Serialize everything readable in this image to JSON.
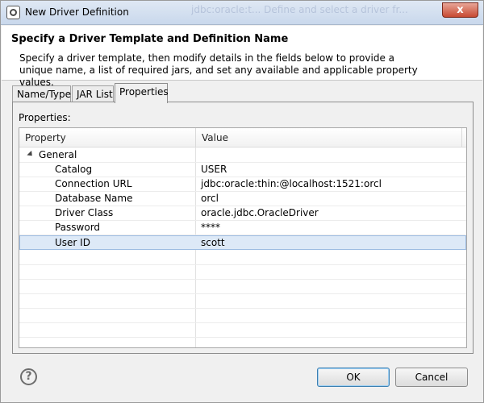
{
  "window": {
    "title": "New Driver Definition",
    "ghost_text": "jdbc:oracle:t...   Define and select a driver fr...",
    "close_label": "x"
  },
  "banner": {
    "title": "Specify a Driver Template and Definition Name",
    "description": "Specify a driver template, then modify details in the fields below to provide a unique name, a list of required jars, and set any available and applicable property values."
  },
  "tabs": [
    {
      "label": "Name/Type",
      "active": false
    },
    {
      "label": "JAR List",
      "active": false
    },
    {
      "label": "Properties",
      "active": true
    }
  ],
  "properties_label": "Properties:",
  "table": {
    "columns": [
      "Property",
      "Value"
    ],
    "group": "General",
    "rows": [
      {
        "property": "Catalog",
        "value": "USER"
      },
      {
        "property": "Connection URL",
        "value": "jdbc:oracle:thin:@localhost:1521:orcl"
      },
      {
        "property": "Database Name",
        "value": "orcl"
      },
      {
        "property": "Driver Class",
        "value": "oracle.jdbc.OracleDriver"
      },
      {
        "property": "Password",
        "value": "****"
      },
      {
        "property": "User ID",
        "value": "scott"
      }
    ],
    "selected_row": 5
  },
  "buttons": {
    "ok": "OK",
    "cancel": "Cancel",
    "help": "?"
  }
}
